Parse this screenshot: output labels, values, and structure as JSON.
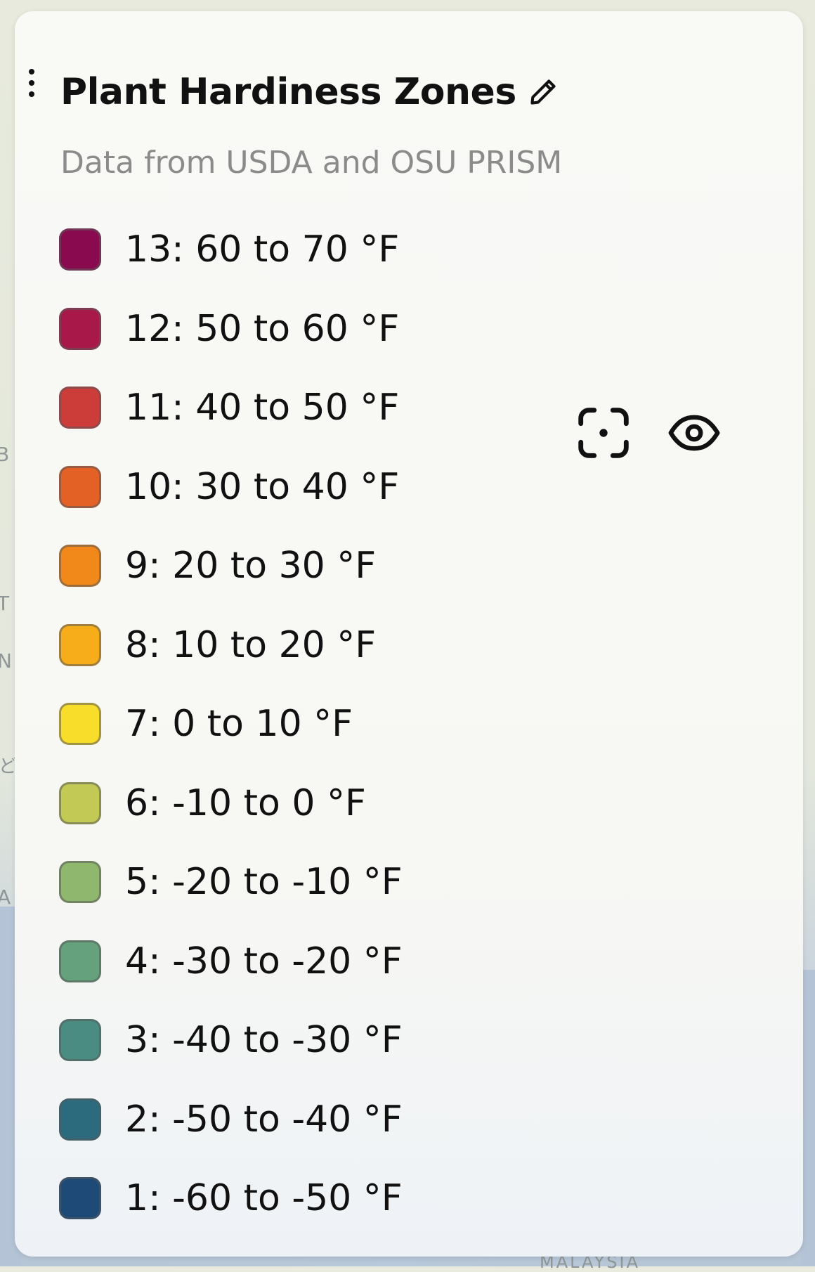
{
  "map": {
    "labels": [
      "B",
      "T",
      "N",
      "ど",
      "A",
      "MALAYSIA"
    ]
  },
  "panel": {
    "title": "Plant Hardiness Zones",
    "subtitle": "Data from USDA and OSU PRISM",
    "icons": {
      "drag": "drag-handle-icon",
      "edit": "pencil-icon",
      "focus": "focus-icon",
      "visibility": "eye-icon"
    },
    "legend": [
      {
        "label": "13: 60 to 70 °F",
        "color": "#8a0a4f"
      },
      {
        "label": "12: 50 to 60 °F",
        "color": "#a8194a"
      },
      {
        "label": "11: 40 to 50 °F",
        "color": "#cc3d3a"
      },
      {
        "label": "10: 30 to 40 °F",
        "color": "#e36125"
      },
      {
        "label": "9: 20 to 30 °F",
        "color": "#f0881a"
      },
      {
        "label": "8: 10 to 20 °F",
        "color": "#f7ad19"
      },
      {
        "label": "7: 0 to 10 °F",
        "color": "#f9dd2b"
      },
      {
        "label": "6: -10 to 0 °F",
        "color": "#c2c954"
      },
      {
        "label": "5: -20 to -10 °F",
        "color": "#8fb76e"
      },
      {
        "label": "4: -30 to -20 °F",
        "color": "#66a17d"
      },
      {
        "label": "3: -40 to -30 °F",
        "color": "#4a8b82"
      },
      {
        "label": "2: -50 to -40 °F",
        "color": "#2c6b7e"
      },
      {
        "label": "1: -60 to -50 °F",
        "color": "#1e4a78"
      }
    ]
  }
}
